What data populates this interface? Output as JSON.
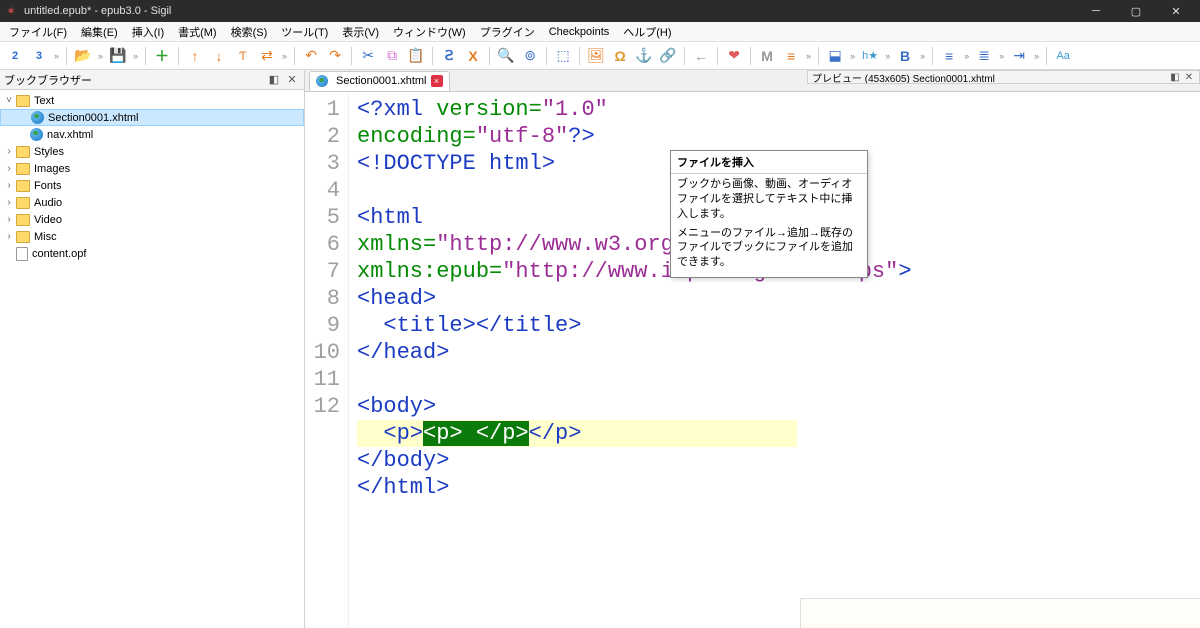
{
  "window": {
    "title": "untitled.epub* - epub3.0 - Sigil"
  },
  "menus": [
    "ファイル(F)",
    "編集(E)",
    "挿入(I)",
    "書式(M)",
    "検索(S)",
    "ツール(T)",
    "表示(V)",
    "ウィンドウ(W)",
    "プラグイン",
    "Checkpoints",
    "ヘルプ(H)"
  ],
  "left_panel": {
    "title": "ブックブラウザー"
  },
  "tree": {
    "root": [
      {
        "kind": "folder",
        "name": "Text",
        "expanded": true,
        "children": [
          {
            "kind": "html",
            "name": "Section0001.xhtml",
            "selected": true
          },
          {
            "kind": "html",
            "name": "nav.xhtml"
          }
        ]
      },
      {
        "kind": "folder",
        "name": "Styles"
      },
      {
        "kind": "folder",
        "name": "Images"
      },
      {
        "kind": "folder",
        "name": "Fonts"
      },
      {
        "kind": "folder",
        "name": "Audio"
      },
      {
        "kind": "folder",
        "name": "Video"
      },
      {
        "kind": "folder",
        "name": "Misc"
      },
      {
        "kind": "file",
        "name": "content.opf"
      }
    ]
  },
  "tabs": {
    "active": "Section0001.xhtml"
  },
  "preview_panel": {
    "title": "プレビュー   (453x605) Section0001.xhtml"
  },
  "tooltip": {
    "title": "ファイルを挿入",
    "line1": "ブックから画像、動画、オーディオファイルを選択してテキスト中に挿入します。",
    "line2": "メニューのファイル→追加→既存のファイルでブックにファイルを追加できます。"
  },
  "code": {
    "lines": [
      "1",
      "2",
      "3",
      "4",
      "5",
      "6",
      "7",
      "8",
      "9",
      "10",
      "11",
      "12"
    ],
    "l1a": "<?xml",
    "l1b": " version=",
    "l1c": "\"1.0\"",
    "l1d": " encoding=",
    "l1e": "\"utf-8\"",
    "l1f": "?>",
    "l2": "<!DOCTYPE html>",
    "l4a": "<html",
    "l4b": " xmlns=",
    "l4c": "\"http://www.w3.org/1999/xhtml\"",
    "l4d": " xmlns:epub=",
    "l4e": "\"http://www.idpf.org/2007/ops\"",
    "l4f": ">",
    "l5": "<head>",
    "l6a": "  <title>",
    "l6b": "</title>",
    "l7": "</head>",
    "l9": "<body>",
    "l10a": "  <p>",
    "l10b": "<p>",
    "l10c": "&#160;",
    "l10d": "</p>",
    "l10e": "</p>",
    "l11": "</body>",
    "l12": "</html>"
  }
}
